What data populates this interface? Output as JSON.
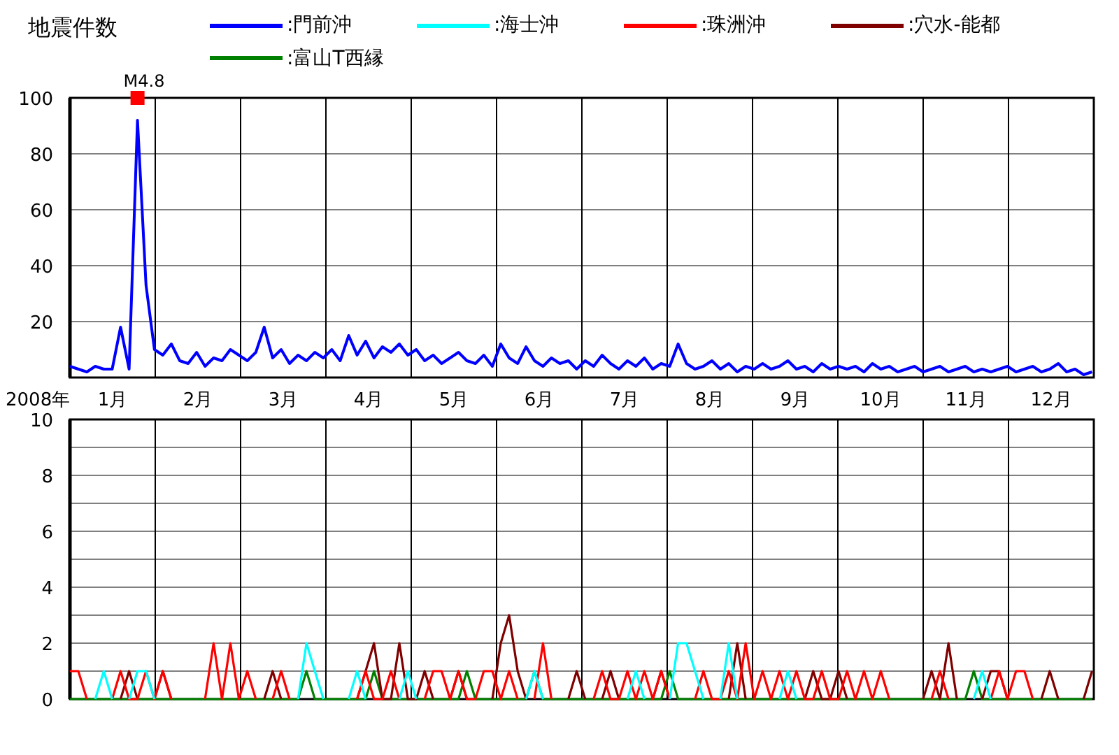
{
  "title": "地震件数",
  "year_label": "2008年",
  "charts": [
    {
      "chart_data": {
        "type": "line",
        "grid": true,
        "xlim": [
          0.5,
          12.5
        ],
        "ylim": [
          0,
          100
        ],
        "yticks": [
          20,
          40,
          60,
          80,
          100
        ],
        "xticks": [
          {
            "value": 1,
            "label": "1月"
          },
          {
            "value": 2,
            "label": "2月"
          },
          {
            "value": 3,
            "label": "3月"
          },
          {
            "value": 4,
            "label": "4月"
          },
          {
            "value": 5,
            "label": "5月"
          },
          {
            "value": 6,
            "label": "6月"
          },
          {
            "value": 7,
            "label": "7月"
          },
          {
            "value": 8,
            "label": "8月"
          },
          {
            "value": 9,
            "label": "9月"
          },
          {
            "value": 10,
            "label": "10月"
          },
          {
            "value": 11,
            "label": "11月"
          },
          {
            "value": 12,
            "label": "12月"
          }
        ],
        "x": [
          0.5,
          0.599,
          0.698,
          0.797,
          0.896,
          0.995,
          1.094,
          1.193,
          1.292,
          1.391,
          1.49,
          1.589,
          1.688,
          1.787,
          1.886,
          1.985,
          2.084,
          2.183,
          2.282,
          2.381,
          2.48,
          2.579,
          2.678,
          2.777,
          2.876,
          2.975,
          3.074,
          3.173,
          3.272,
          3.371,
          3.47,
          3.569,
          3.668,
          3.767,
          3.866,
          3.965,
          4.064,
          4.163,
          4.262,
          4.361,
          4.46,
          4.559,
          4.658,
          4.757,
          4.856,
          4.955,
          5.054,
          5.153,
          5.252,
          5.351,
          5.45,
          5.549,
          5.648,
          5.747,
          5.846,
          5.945,
          6.044,
          6.143,
          6.242,
          6.341,
          6.44,
          6.539,
          6.638,
          6.737,
          6.836,
          6.935,
          7.034,
          7.133,
          7.232,
          7.331,
          7.43,
          7.529,
          7.628,
          7.727,
          7.826,
          7.925,
          8.024,
          8.123,
          8.222,
          8.321,
          8.42,
          8.519,
          8.618,
          8.717,
          8.816,
          8.915,
          9.014,
          9.113,
          9.212,
          9.311,
          9.41,
          9.509,
          9.608,
          9.707,
          9.806,
          9.905,
          10.004,
          10.103,
          10.202,
          10.301,
          10.4,
          10.499,
          10.598,
          10.697,
          10.796,
          10.895,
          10.994,
          11.093,
          11.192,
          11.291,
          11.39,
          11.489,
          11.588,
          11.687,
          11.786,
          11.885,
          11.984,
          12.083,
          12.182,
          12.281,
          12.38,
          12.479
        ],
        "series": [
          {
            "name": ":門前沖",
            "color": "#0000ff",
            "values": [
              4,
              3,
              2,
              4,
              3,
              3,
              18,
              3,
              92,
              33,
              10,
              8,
              12,
              6,
              5,
              9,
              4,
              7,
              6,
              10,
              8,
              6,
              9,
              18,
              7,
              10,
              5,
              8,
              6,
              9,
              7,
              10,
              6,
              15,
              8,
              13,
              7,
              11,
              9,
              12,
              8,
              10,
              6,
              8,
              5,
              7,
              9,
              6,
              5,
              8,
              4,
              12,
              7,
              5,
              11,
              6,
              4,
              7,
              5,
              6,
              3,
              6,
              4,
              8,
              5,
              3,
              6,
              4,
              7,
              3,
              5,
              4,
              12,
              5,
              3,
              4,
              6,
              3,
              5,
              2,
              4,
              3,
              5,
              3,
              4,
              6,
              3,
              4,
              2,
              5,
              3,
              4,
              3,
              4,
              2,
              5,
              3,
              4,
              2,
              3,
              4,
              2,
              3,
              4,
              2,
              3,
              4,
              2,
              3,
              2,
              3,
              4,
              2,
              3,
              4,
              2,
              3,
              5,
              2,
              3,
              1,
              2
            ]
          }
        ],
        "annotations": [
          {
            "text": "M4.8",
            "x": 1.292,
            "y": 100
          }
        ]
      }
    },
    {
      "chart_data": {
        "type": "line",
        "grid": true,
        "xlim": [
          0.5,
          12.5
        ],
        "ylim": [
          0,
          10
        ],
        "yticks": [
          0,
          2,
          4,
          6,
          8,
          10
        ],
        "x": [
          0.5,
          0.599,
          0.698,
          0.797,
          0.896,
          0.995,
          1.094,
          1.193,
          1.292,
          1.391,
          1.49,
          1.589,
          1.688,
          1.787,
          1.886,
          1.985,
          2.084,
          2.183,
          2.282,
          2.381,
          2.48,
          2.579,
          2.678,
          2.777,
          2.876,
          2.975,
          3.074,
          3.173,
          3.272,
          3.371,
          3.47,
          3.569,
          3.668,
          3.767,
          3.866,
          3.965,
          4.064,
          4.163,
          4.262,
          4.361,
          4.46,
          4.559,
          4.658,
          4.757,
          4.856,
          4.955,
          5.054,
          5.153,
          5.252,
          5.351,
          5.45,
          5.549,
          5.648,
          5.747,
          5.846,
          5.945,
          6.044,
          6.143,
          6.242,
          6.341,
          6.44,
          6.539,
          6.638,
          6.737,
          6.836,
          6.935,
          7.034,
          7.133,
          7.232,
          7.331,
          7.43,
          7.529,
          7.628,
          7.727,
          7.826,
          7.925,
          8.024,
          8.123,
          8.222,
          8.321,
          8.42,
          8.519,
          8.618,
          8.717,
          8.816,
          8.915,
          9.014,
          9.113,
          9.212,
          9.311,
          9.41,
          9.509,
          9.608,
          9.707,
          9.806,
          9.905,
          10.004,
          10.103,
          10.202,
          10.301,
          10.4,
          10.499,
          10.598,
          10.697,
          10.796,
          10.895,
          10.994,
          11.093,
          11.192,
          11.291,
          11.39,
          11.489,
          11.588,
          11.687,
          11.786,
          11.885,
          11.984,
          12.083,
          12.182,
          12.281,
          12.38,
          12.479
        ],
        "series": [
          {
            "name": ":海士沖",
            "color": "#00ffff",
            "values": [
              null,
              null,
              null,
              0,
              1,
              0,
              null,
              0,
              1,
              1,
              0,
              null,
              null,
              null,
              null,
              null,
              null,
              null,
              null,
              null,
              null,
              null,
              null,
              null,
              null,
              null,
              null,
              0,
              2,
              1,
              0,
              null,
              null,
              0,
              1,
              0,
              null,
              null,
              null,
              0,
              1,
              0,
              null,
              null,
              null,
              null,
              null,
              null,
              null,
              null,
              null,
              null,
              null,
              null,
              0,
              1,
              0,
              null,
              null,
              null,
              null,
              null,
              null,
              null,
              null,
              null,
              0,
              1,
              0,
              null,
              null,
              0,
              2,
              2,
              1,
              0,
              null,
              0,
              2,
              0,
              null,
              null,
              null,
              null,
              0,
              1,
              0,
              null,
              null,
              null,
              null,
              null,
              null,
              null,
              null,
              null,
              null,
              null,
              null,
              null,
              null,
              null,
              null,
              null,
              null,
              null,
              null,
              0,
              1,
              0,
              null,
              null,
              null,
              null,
              null,
              null,
              null,
              null,
              null,
              null,
              null,
              null
            ]
          },
          {
            "name": ":珠洲沖",
            "color": "#ff0000",
            "values": [
              1,
              1,
              0,
              null,
              null,
              0,
              1,
              0,
              0,
              1,
              0,
              1,
              0,
              null,
              null,
              null,
              0,
              2,
              0,
              2,
              0,
              1,
              0,
              null,
              0,
              1,
              0,
              null,
              null,
              null,
              null,
              null,
              null,
              null,
              0,
              1,
              0,
              0,
              1,
              0,
              null,
              null,
              0,
              1,
              1,
              0,
              1,
              0,
              0,
              1,
              1,
              0,
              1,
              0,
              null,
              0,
              2,
              0,
              null,
              null,
              null,
              null,
              0,
              1,
              0,
              0,
              1,
              0,
              1,
              0,
              1,
              0,
              null,
              null,
              0,
              1,
              0,
              0,
              1,
              0,
              2,
              0,
              1,
              0,
              1,
              0,
              1,
              0,
              0,
              1,
              0,
              0,
              1,
              0,
              1,
              0,
              1,
              0,
              null,
              null,
              null,
              null,
              0,
              1,
              0,
              null,
              null,
              null,
              null,
              0,
              1,
              0,
              1,
              1,
              0,
              null,
              null,
              null,
              null,
              null,
              null,
              null
            ]
          },
          {
            "name": ":穴水-能都",
            "color": "#800000",
            "values": [
              null,
              null,
              null,
              null,
              null,
              null,
              0,
              1,
              0,
              null,
              0,
              1,
              0,
              null,
              null,
              null,
              null,
              null,
              null,
              null,
              null,
              null,
              null,
              0,
              1,
              0,
              null,
              null,
              null,
              null,
              null,
              null,
              null,
              null,
              0,
              1,
              2,
              0,
              0,
              2,
              0,
              0,
              1,
              0,
              null,
              0,
              1,
              0,
              null,
              null,
              0,
              2,
              3,
              1,
              0,
              null,
              null,
              null,
              null,
              0,
              1,
              0,
              null,
              0,
              1,
              0,
              null,
              null,
              null,
              0,
              1,
              0,
              null,
              null,
              null,
              null,
              null,
              null,
              0,
              2,
              0,
              null,
              null,
              null,
              null,
              null,
              null,
              0,
              1,
              0,
              0,
              1,
              0,
              null,
              null,
              null,
              null,
              null,
              null,
              null,
              null,
              0,
              1,
              0,
              2,
              0,
              null,
              null,
              0,
              1,
              1,
              0,
              null,
              null,
              null,
              0,
              1,
              0,
              null,
              null,
              0,
              1
            ]
          },
          {
            "name": ":富山T西縁",
            "color": "#008000",
            "values": [
              0,
              0,
              0,
              0,
              0,
              0,
              0,
              0,
              0,
              0,
              0,
              0,
              0,
              0,
              0,
              0,
              0,
              0,
              0,
              0,
              0,
              0,
              0,
              0,
              0,
              0,
              0,
              0,
              1,
              0,
              0,
              0,
              0,
              0,
              0,
              0,
              1,
              0,
              0,
              0,
              0,
              0,
              0,
              0,
              0,
              0,
              0,
              1,
              0,
              0,
              0,
              0,
              0,
              0,
              0,
              1,
              0,
              0,
              0,
              0,
              0,
              0,
              0,
              0,
              0,
              0,
              0,
              0,
              0,
              0,
              0,
              1,
              0,
              0,
              0,
              0,
              0,
              0,
              0,
              0,
              0,
              0,
              0,
              0,
              0,
              0,
              0,
              0,
              0,
              0,
              0,
              0,
              0,
              0,
              0,
              0,
              0,
              0,
              0,
              0,
              0,
              0,
              0,
              0,
              0,
              0,
              0,
              1,
              0,
              0,
              0,
              0,
              0,
              0,
              0,
              0,
              0,
              0,
              0,
              0,
              0,
              0
            ]
          }
        ]
      }
    }
  ]
}
